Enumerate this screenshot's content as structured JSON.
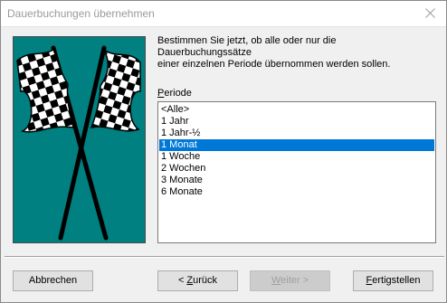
{
  "window": {
    "title": "Dauerbuchungen übernehmen"
  },
  "illustration": {
    "icon": "checkered-flags",
    "background_color": "#008080"
  },
  "instruction_text": "Bestimmen Sie jetzt, ob alle oder nur die Dauerbuchungssätze\neiner einzelnen Periode übernommen werden sollen.",
  "period": {
    "label_mnemonic": "P",
    "label_rest": "eriode",
    "items": [
      "<Alle>",
      "1 Jahr",
      "1 Jahr-½",
      "1 Monat",
      "1 Woche",
      "2 Wochen",
      "3 Monate",
      "6 Monate"
    ],
    "selected_index": 3
  },
  "buttons": {
    "cancel": "Abbrechen",
    "back_prefix": "< ",
    "back_mnemonic": "Z",
    "back_rest": "urück",
    "next_mnemonic": "W",
    "next_rest": "eiter >",
    "finish_mnemonic": "F",
    "finish_rest": "ertigstellen"
  },
  "colors": {
    "selection": "#0078d7",
    "illustration_bg": "#008080"
  }
}
